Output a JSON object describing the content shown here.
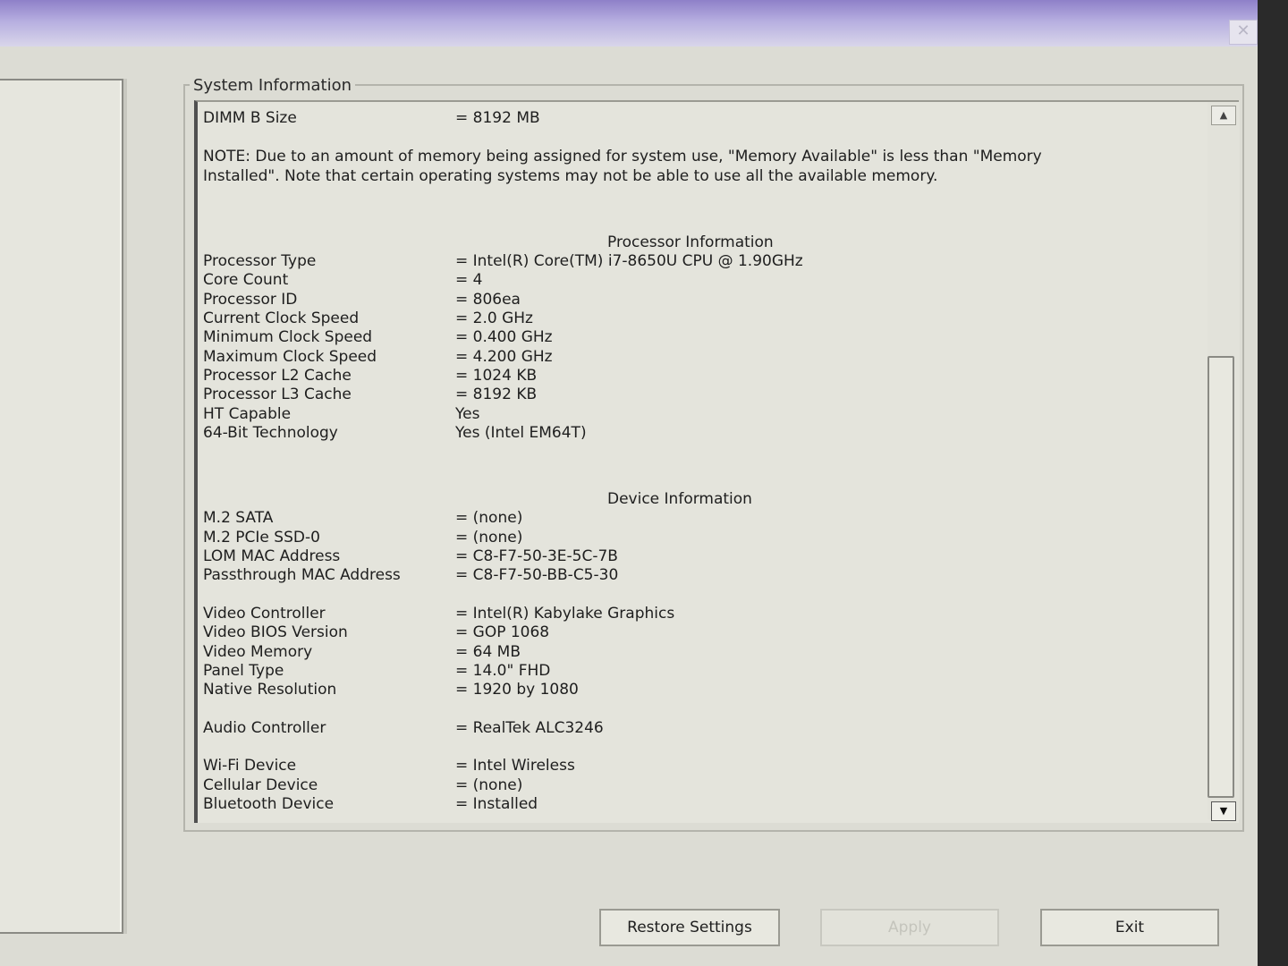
{
  "window": {
    "close_glyph": "✕"
  },
  "group": {
    "title": "System Information"
  },
  "memory": {
    "dimm_b_size": {
      "label": "DIMM B Size",
      "value": "= 8192 MB"
    },
    "note": "NOTE: Due to an amount of memory being assigned for system use, \"Memory Available\" is less than \"Memory Installed\". Note that certain operating systems may not be able to use all the available memory."
  },
  "processor": {
    "title": "Processor Information",
    "rows": [
      {
        "label": "Processor Type",
        "value": "= Intel(R) Core(TM) i7-8650U CPU @ 1.90GHz"
      },
      {
        "label": "Core Count",
        "value": "= 4"
      },
      {
        "label": "Processor ID",
        "value": "= 806ea"
      },
      {
        "label": "Current Clock Speed",
        "value": "= 2.0 GHz"
      },
      {
        "label": "Minimum Clock Speed",
        "value": "= 0.400 GHz"
      },
      {
        "label": "Maximum Clock Speed",
        "value": "= 4.200 GHz"
      },
      {
        "label": "Processor L2 Cache",
        "value": "= 1024 KB"
      },
      {
        "label": "Processor L3 Cache",
        "value": "= 8192 KB"
      },
      {
        "label": "HT Capable",
        "value": "Yes"
      },
      {
        "label": "64-Bit Technology",
        "value": "Yes (Intel EM64T)"
      }
    ]
  },
  "device": {
    "title": "Device Information",
    "storage": [
      {
        "label": "M.2 SATA",
        "value": "= (none)"
      },
      {
        "label": "M.2 PCIe SSD-0",
        "value": "= (none)"
      },
      {
        "label": "LOM MAC Address",
        "value": "= C8-F7-50-3E-5C-7B"
      },
      {
        "label": "Passthrough MAC Address",
        "value": "= C8-F7-50-BB-C5-30"
      }
    ],
    "video": [
      {
        "label": "Video Controller",
        "value": "= Intel(R) Kabylake Graphics"
      },
      {
        "label": "Video BIOS Version",
        "value": "= GOP 1068"
      },
      {
        "label": "Video Memory",
        "value": "= 64 MB"
      },
      {
        "label": "Panel Type",
        "value": "= 14.0\" FHD"
      },
      {
        "label": "Native Resolution",
        "value": "= 1920 by 1080"
      }
    ],
    "audio": [
      {
        "label": "Audio Controller",
        "value": "= RealTek ALC3246"
      }
    ],
    "wireless": [
      {
        "label": "Wi-Fi Device",
        "value": "= Intel Wireless"
      },
      {
        "label": "Cellular Device",
        "value": "= (none)"
      },
      {
        "label": "Bluetooth Device",
        "value": "= Installed"
      }
    ]
  },
  "scrollbar": {
    "up_glyph": "▲",
    "down_glyph": "▼"
  },
  "buttons": {
    "restore": "Restore Settings",
    "apply": "Apply",
    "exit": "Exit"
  }
}
